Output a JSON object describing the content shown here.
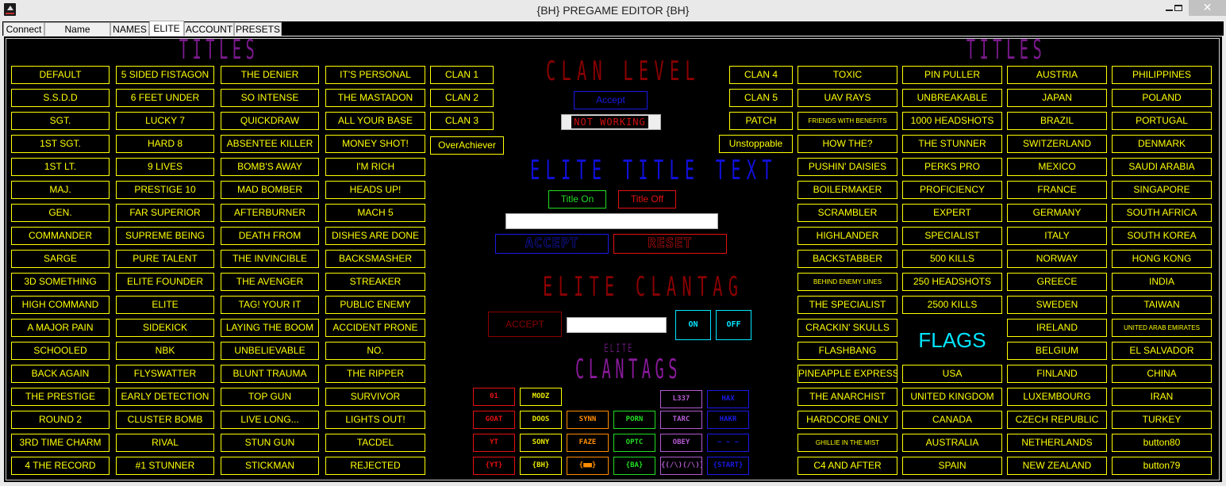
{
  "window": {
    "title": "{BH} PREGAME EDITOR {BH}",
    "minimize_icon": "minimize-icon",
    "maximize_icon": "maximize-icon",
    "close_icon": "close-icon",
    "close_glyph": "✕"
  },
  "tabs": [
    {
      "label": "Connect",
      "active": false
    },
    {
      "label": "Name Changer",
      "active": false
    },
    {
      "label": "NAMES",
      "active": false
    },
    {
      "label": "ELITE",
      "active": true
    },
    {
      "label": "ACCOUNT",
      "active": false
    },
    {
      "label": "PRESETS",
      "active": false
    }
  ],
  "headings": {
    "titles_left": "TITLES",
    "titles_right": "TITLES",
    "clan_level": "CLAN LEVEL",
    "elite_title_text": "ELITE TITLE TEXT",
    "elite_clantag": "ELITE CLANTAG",
    "elite_small": "ELITE",
    "clantags": "CLANTAGS",
    "flags": "FLAGS"
  },
  "left_titles": {
    "columns": [
      [
        "DEFAULT",
        "S.S.D.D",
        "SGT.",
        "1ST SGT.",
        "1ST LT.",
        "MAJ.",
        "GEN.",
        "COMMANDER",
        "SARGE",
        "3D SOMETHING",
        "HIGH COMMAND",
        "A MAJOR PAIN",
        "SCHOOLED",
        "BACK AGAIN",
        "THE PRESTIGE",
        "ROUND 2",
        "3RD TIME CHARM",
        "4 THE RECORD"
      ],
      [
        "5 SIDED FISTAGON",
        "6 FEET UNDER",
        "LUCKY 7",
        "HARD 8",
        "9 LIVES",
        "PRESTIGE 10",
        "FAR SUPERIOR",
        "SUPREME BEING",
        "PURE TALENT",
        "ELITE FOUNDER",
        "ELITE",
        "SIDEKICK",
        "NBK",
        "FLYSWATTER",
        "EARLY DETECTION",
        "CLUSTER BOMB",
        "RIVAL",
        "#1 STUNNER"
      ],
      [
        "THE DENIER",
        "SO INTENSE",
        "QUICKDRAW",
        "ABSENTEE KILLER",
        "BOMB'S AWAY",
        "MAD BOMBER",
        "AFTERBURNER",
        "DEATH FROM",
        "THE INVINCIBLE",
        "THE AVENGER",
        "TAG! YOUR IT",
        "LAYING THE BOOM",
        "UNBELIEVABLE",
        "BLUNT TRAUMA",
        "TOP GUN",
        "LIVE LONG...",
        "STUN GUN",
        "STICKMAN"
      ],
      [
        "IT'S PERSONAL",
        "THE MASTADON",
        "ALL YOUR BASE",
        "MONEY SHOT!",
        "I'M RICH",
        "HEADS UP!",
        "MACH 5",
        "DISHES ARE DONE",
        "BACKSMASHER",
        "STREAKER",
        "PUBLIC ENEMY",
        "ACCIDENT PRONE",
        "NO.",
        "THE RIPPER",
        "SURVIVOR",
        "LIGHTS OUT!",
        "TACDEL",
        "REJECTED"
      ]
    ]
  },
  "clan_left": [
    "CLAN 1",
    "CLAN 2",
    "CLAN 3",
    "OverAchiever"
  ],
  "clan_right": [
    "CLAN 4",
    "CLAN 5",
    "PATCH",
    "Unstoppable"
  ],
  "clan_level": {
    "accept_label": "Accept",
    "status_text": "NOT WORKING"
  },
  "elite_title": {
    "title_on_label": "Title On",
    "title_off_label": "Title Off",
    "input_value": "",
    "input_placeholder": "",
    "accept_label": "ACCEPT",
    "reset_label": "RESET"
  },
  "elite_clantag": {
    "accept_label": "ACCEPT",
    "input_value": "",
    "input_placeholder": "",
    "on_label": "ON",
    "off_label": "OFF"
  },
  "clantags": {
    "colors": {
      "red": "#e61010",
      "yellow": "#ffff00",
      "orange": "#ff8c00",
      "green": "#22dd22",
      "violet": "#b45ad2",
      "blue": "#1a1ae6"
    },
    "columns": [
      {
        "color": "red",
        "items": [
          "01",
          "GOAT",
          "YT",
          "{YT}"
        ]
      },
      {
        "color": "yellow",
        "items": [
          "MODZ",
          "DOOS",
          "SONY",
          "{BH}"
        ]
      },
      {
        "color": "orange",
        "items": [
          "SYNN",
          "FAZE",
          "{■■}"
        ]
      },
      {
        "color": "green",
        "items": [
          "PORN",
          "OPTC",
          "{BA}"
        ]
      },
      {
        "color": "violet",
        "items": [
          "L337",
          "TARC",
          "OBEY",
          "{(/\\)(/\\)}"
        ]
      },
      {
        "color": "blue",
        "items": [
          "HAX",
          "HAKR",
          "~ ~ ~",
          "{START}"
        ]
      }
    ]
  },
  "right_titles": {
    "columns": [
      [
        "TOXIC",
        "UAV RAYS",
        "FRIENDS WITH BENEFITS",
        "HOW THE?",
        "PUSHIN' DAISIES",
        "BOILERMAKER",
        "SCRAMBLER",
        "HIGHLANDER",
        "BACKSTABBER",
        "BEHIND ENEMY LINES",
        "THE SPECIALIST",
        "CRACKIN' SKULLS",
        "FLASHBANG",
        "PINEAPPLE EXPRESS",
        "THE ANARCHIST",
        "HARDCORE ONLY",
        "GHILLIE IN THE MIST",
        "C4 AND AFTER"
      ],
      [
        "PIN PULLER",
        "UNBREAKABLE",
        "1000 HEADSHOTS",
        "THE STUNNER",
        "PERKS PRO",
        "PROFICIENCY",
        "EXPERT",
        "SPECIALIST",
        "500 KILLS",
        "250 HEADSHOTS",
        "2500 KILLS"
      ],
      [
        "AUSTRIA",
        "JAPAN",
        "BRAZIL",
        "SWITZERLAND",
        "MEXICO",
        "FRANCE",
        "GERMANY",
        "ITALY",
        "NORWAY",
        "GREECE",
        "SWEDEN",
        "IRELAND",
        "BELGIUM",
        "FINLAND",
        "LUXEMBOURG",
        "CZECH REPUBLIC",
        "NETHERLANDS",
        "NEW ZEALAND"
      ],
      [
        "PHILIPPINES",
        "POLAND",
        "PORTUGAL",
        "DENMARK",
        "SAUDI ARABIA",
        "SINGAPORE",
        "SOUTH AFRICA",
        "SOUTH KOREA",
        "HONG KONG",
        "INDIA",
        "TAIWAN",
        "UNITED ARAB EMIRATES",
        "EL SALVADOR",
        "CHINA",
        "IRAN",
        "TURKEY",
        "button80",
        "button79"
      ]
    ],
    "flags_column_tail": [
      "USA",
      "UNITED KINGDOM",
      "CANADA",
      "AUSTRALIA",
      "SPAIN"
    ]
  }
}
